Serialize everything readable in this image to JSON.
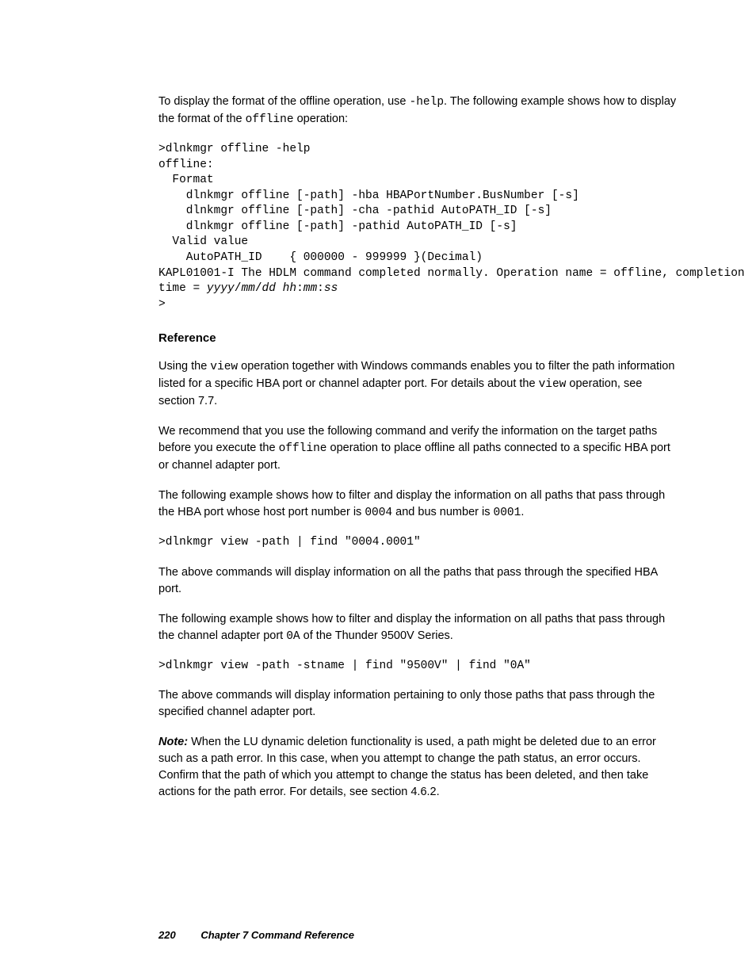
{
  "p_intro_1": "To display the format of the offline operation, use ",
  "p_intro_code1": "-help",
  "p_intro_2": ". The following example shows how to display the format of the ",
  "p_intro_code2": "offline",
  "p_intro_3": " operation:",
  "pre_help_1": ">dlnkmgr offline -help\noffline:\n  Format\n    dlnkmgr offline [-path] -hba HBAPortNumber.BusNumber [-s]\n    dlnkmgr offline [-path] -cha -pathid AutoPATH_ID [-s]\n    dlnkmgr offline [-path] -pathid AutoPATH_ID [-s]\n  Valid value\n    AutoPATH_ID    { 000000 - 999999 }(Decimal)\nKAPL01001-I The HDLM command completed normally. Operation name = offline, completion\ntime = ",
  "pre_help_ital": "yyyy",
  "pre_help_slash1": "/",
  "pre_help_mm": "mm",
  "pre_help_slash2": "/",
  "pre_help_dd": "dd",
  "pre_help_sp": " ",
  "pre_help_hh": "hh",
  "pre_help_c1": ":",
  "pre_help_mm2": "mm",
  "pre_help_c2": ":",
  "pre_help_ss": "ss",
  "pre_help_end": "\n>",
  "h_reference": "Reference",
  "p_ref_1a": "Using the ",
  "p_ref_1code": "view",
  "p_ref_1b": " operation together with Windows commands enables you to filter the path information listed for a specific HBA port or channel adapter port. For details about the ",
  "p_ref_1code2": "view",
  "p_ref_1c": " operation, see section 7.7.",
  "p_ref_2a": "We recommend that you use the following command and verify the information on the target paths before you execute the ",
  "p_ref_2code": "offline",
  "p_ref_2b": " operation to place offline all paths connected to a specific HBA port or channel adapter port.",
  "p_ref_3a": "The following example shows how to filter and display the information on all paths that pass through the HBA port whose host port number is ",
  "p_ref_3code1": "0004",
  "p_ref_3b": " and bus number is ",
  "p_ref_3code2": "0001",
  "p_ref_3c": ".",
  "pre_cmd1": ">dlnkmgr view -path | find \"0004.0001\"",
  "p_ref_4": "The above commands will display information on all the paths that pass through the specified HBA port.",
  "p_ref_5a": "The following example shows how to filter and display the information on all paths that pass through the channel adapter port ",
  "p_ref_5code": "0A",
  "p_ref_5b": " of the Thunder 9500V Series.",
  "pre_cmd2": ">dlnkmgr view -path -stname | find \"9500V\" | find \"0A\"",
  "p_ref_6": "The above commands will display information pertaining to only those paths that pass through the specified channel adapter port.",
  "note_label": "Note:",
  "note_body": " When the LU dynamic deletion functionality is used, a path might be deleted due to an error such as a path error. In this case, when you attempt to change the path status, an error occurs. Confirm that the path of which you attempt to change the status has been deleted, and then take actions for the path error. For details, see section 4.6.2.",
  "footer_page": "220",
  "footer_chapter": "Chapter 7   Command Reference"
}
